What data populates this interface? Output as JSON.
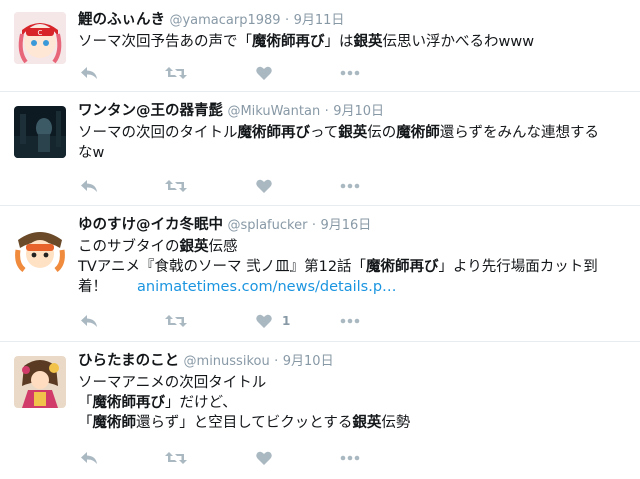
{
  "tweets": [
    {
      "name": "鯉のふぃんき",
      "handle": "@yamacarp1989",
      "separator": "·",
      "date": "9月11日",
      "lines": [
        [
          "ソーマ次回予告あの声で「",
          "魔術師再び",
          "」は",
          "銀英",
          "伝思い浮かべるわwww"
        ]
      ],
      "like_count": ""
    },
    {
      "name": "ワンタン@王の器青髭",
      "handle": "@MikuWantan",
      "separator": "·",
      "date": "9月10日",
      "lines": [
        [
          "ソーマの次回のタイトル",
          "魔術師再び",
          "って",
          "銀英",
          "伝の",
          "魔術師",
          "還らずをみんな連想する"
        ],
        [
          "なw"
        ]
      ],
      "like_count": ""
    },
    {
      "name": "ゆのすけ@イカ冬眠中",
      "handle": "@splafucker",
      "separator": "·",
      "date": "9月16日",
      "lines": [
        [
          "このサブタイの",
          "銀英",
          "伝感"
        ],
        [
          "TVアニメ『食戟のソーマ 弐ノ皿』第12話「",
          "魔術師再び",
          "」より先行場面カット到"
        ],
        [
          "着！"
        ]
      ],
      "link": "animatetimes.com/news/details.p…",
      "like_count": "1"
    },
    {
      "name": "ひらたまのこと",
      "handle": "@minussikou",
      "separator": "·",
      "date": "9月10日",
      "lines": [
        [
          "ソーマアニメの次回タイトル"
        ],
        [
          "「",
          "魔術師再び",
          "」だけど、"
        ],
        [
          "「",
          "魔術師",
          "還らず」と空目してビクッとする",
          "銀英",
          "伝勢"
        ]
      ],
      "like_count": ""
    }
  ],
  "icons": [
    "reply-icon",
    "retweet-icon",
    "like-icon",
    "more-icon"
  ],
  "colors": {
    "icon": "#aab8c2",
    "link": "#1b95e0",
    "muted": "#8899a6",
    "divider": "#e6ecf0"
  }
}
